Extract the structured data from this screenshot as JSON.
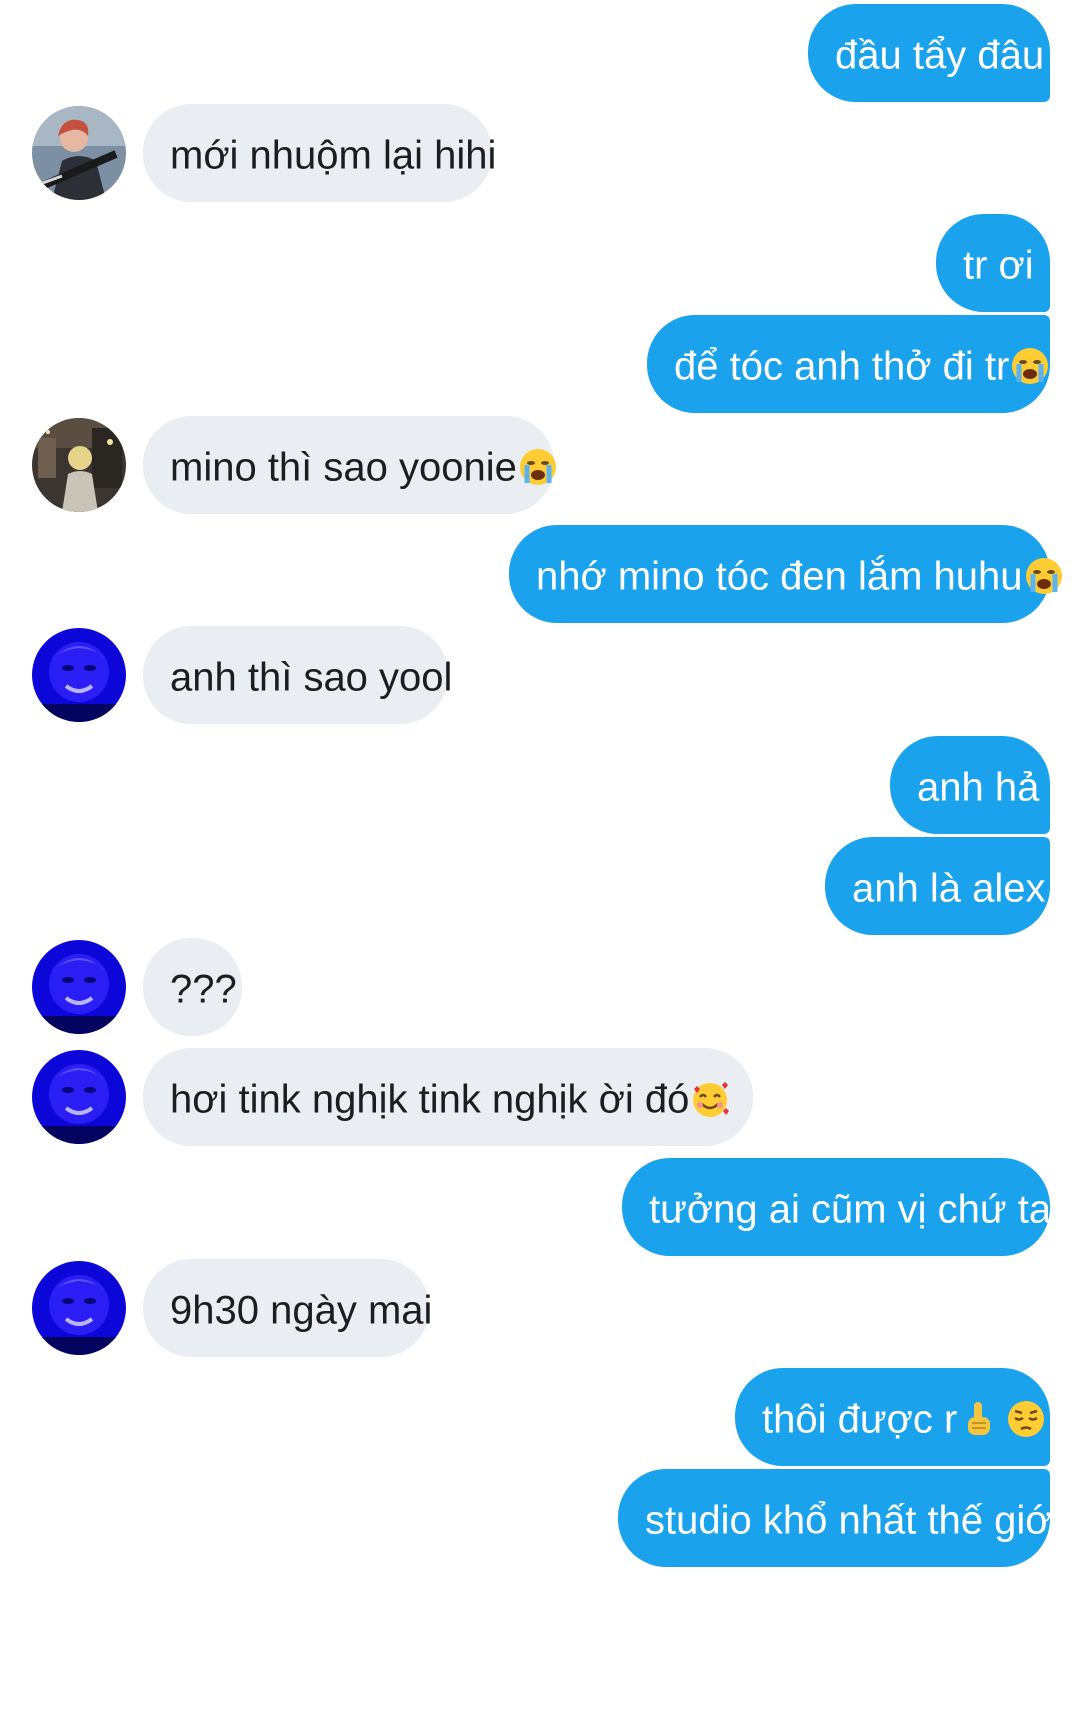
{
  "conversation": {
    "messages": [
      {
        "side": "out",
        "text": "đầu tẩy đâu"
      },
      {
        "side": "in",
        "avatar": "guitar-player-avatar",
        "text": "mới nhuộm lại hihi"
      },
      {
        "side": "out",
        "text": "tr ơi"
      },
      {
        "side": "out",
        "text": "để tóc anh thở đi tr",
        "emoji": "loudly-crying-face-emoji"
      },
      {
        "side": "in",
        "avatar": "street-photo-avatar",
        "text": "mino thì sao yoonie",
        "emoji": "loudly-crying-face-emoji"
      },
      {
        "side": "out",
        "text": "nhớ mino tóc đen lắm huhu",
        "emoji": "loudly-crying-face-emoji"
      },
      {
        "side": "in",
        "avatar": "blue-face-avatar",
        "text": "anh thì sao yool"
      },
      {
        "side": "out",
        "text": "anh hả"
      },
      {
        "side": "out",
        "text": "anh là alex"
      },
      {
        "side": "in",
        "avatar": "blue-face-avatar",
        "text": "???"
      },
      {
        "side": "in",
        "avatar": "blue-face-avatar",
        "text": "hơi tink nghịk tink nghịk ời đó",
        "emoji": "smiling-face-with-hearts-emoji"
      },
      {
        "side": "out",
        "text": "tưởng ai cũm vị chứ tar"
      },
      {
        "side": "in",
        "avatar": "blue-face-avatar",
        "text": "9h30 ngày mai"
      },
      {
        "side": "out",
        "text": "thôi được r",
        "emoji": "index-pointing-up-emoji",
        "emoji2": "pensive-face-emoji"
      },
      {
        "side": "out",
        "text": "studio khổ nhất thế giới"
      }
    ]
  },
  "colors": {
    "outgoing_bubble": "#1aa3ec",
    "incoming_bubble": "#eaedf1",
    "incoming_text": "#1d1d1f",
    "outgoing_text": "#ffffff"
  }
}
